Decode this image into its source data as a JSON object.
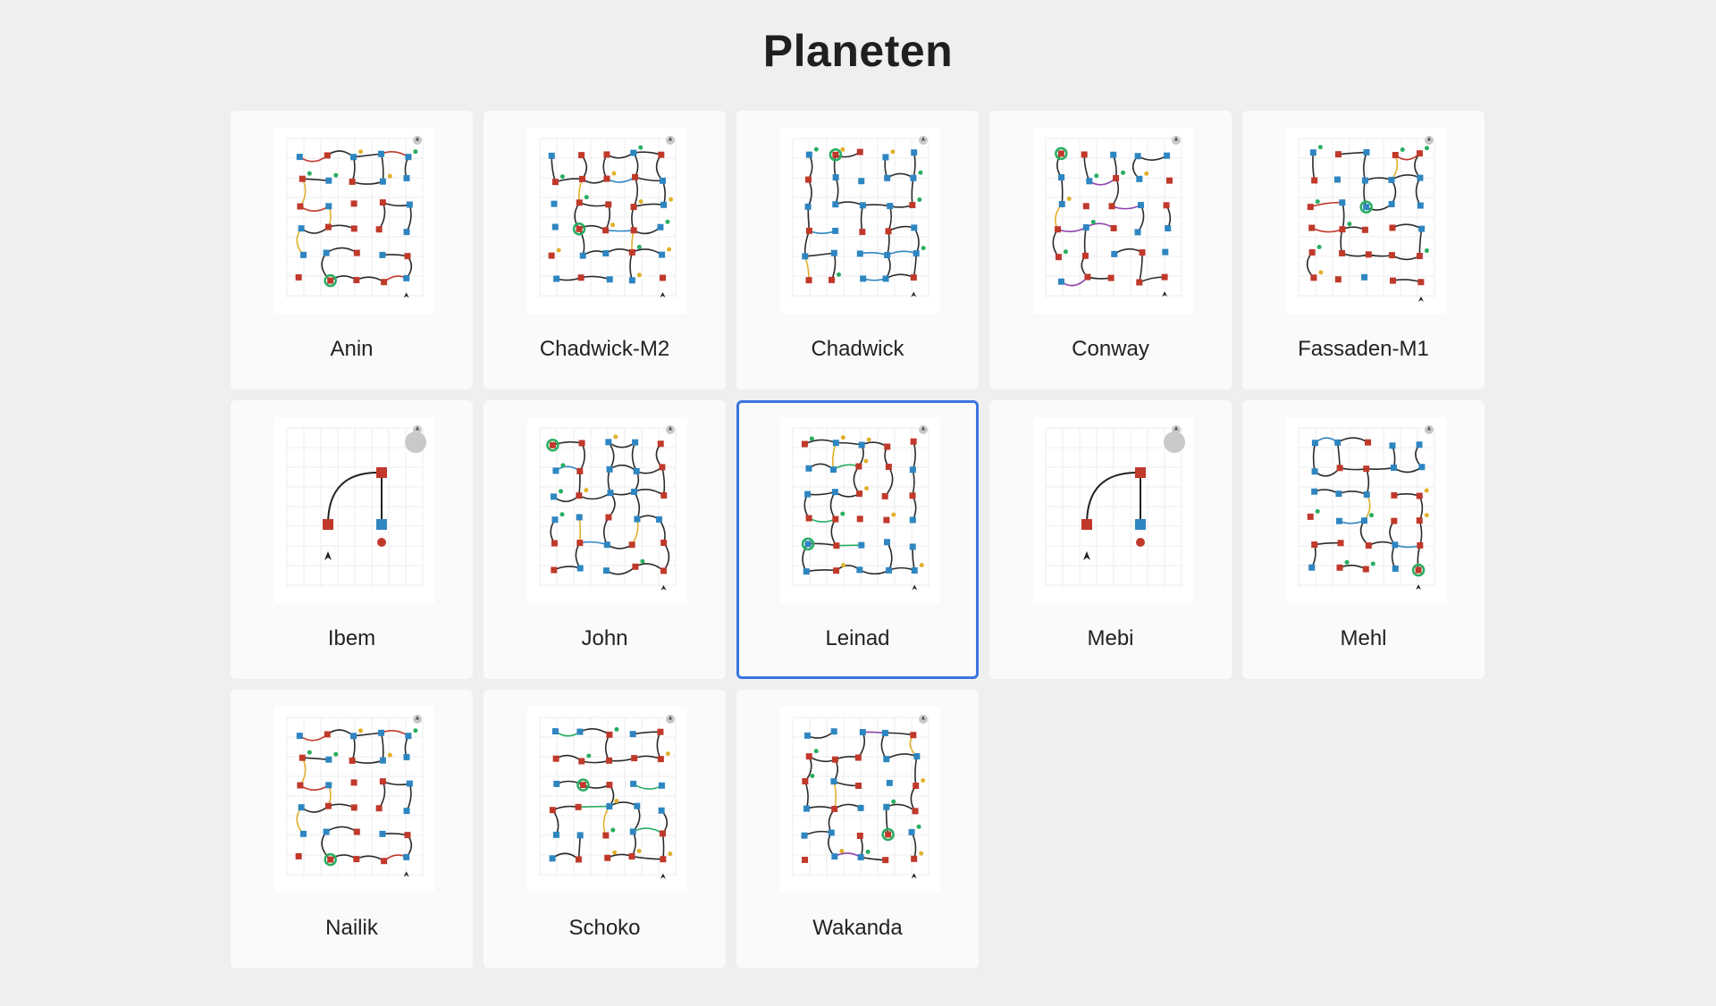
{
  "page": {
    "title": "Planeten"
  },
  "planets": [
    {
      "name": "Anin",
      "selected": false,
      "variant": 0,
      "accent": "#c0392b"
    },
    {
      "name": "Chadwick-M2",
      "selected": false,
      "variant": 1,
      "accent": "#2e86c1"
    },
    {
      "name": "Chadwick",
      "selected": false,
      "variant": 2,
      "accent": "#2e86c1"
    },
    {
      "name": "Conway",
      "selected": false,
      "variant": 3,
      "accent": "#8e44ad"
    },
    {
      "name": "Fassaden-M1",
      "selected": false,
      "variant": 4,
      "accent": "#c0392b"
    },
    {
      "name": "Ibem",
      "selected": false,
      "variant": 5,
      "accent": "#c0392b"
    },
    {
      "name": "John",
      "selected": false,
      "variant": 6,
      "accent": "#2e86c1"
    },
    {
      "name": "Leinad",
      "selected": true,
      "variant": 7,
      "accent": "#27ae60"
    },
    {
      "name": "Mebi",
      "selected": false,
      "variant": 5,
      "accent": "#c0392b"
    },
    {
      "name": "Mehl",
      "selected": false,
      "variant": 8,
      "accent": "#2e86c1"
    },
    {
      "name": "Nailik",
      "selected": false,
      "variant": 0,
      "accent": "#c0392b"
    },
    {
      "name": "Schoko",
      "selected": false,
      "variant": 9,
      "accent": "#27ae60"
    },
    {
      "name": "Wakanda",
      "selected": false,
      "variant": 10,
      "accent": "#8e44ad"
    }
  ]
}
